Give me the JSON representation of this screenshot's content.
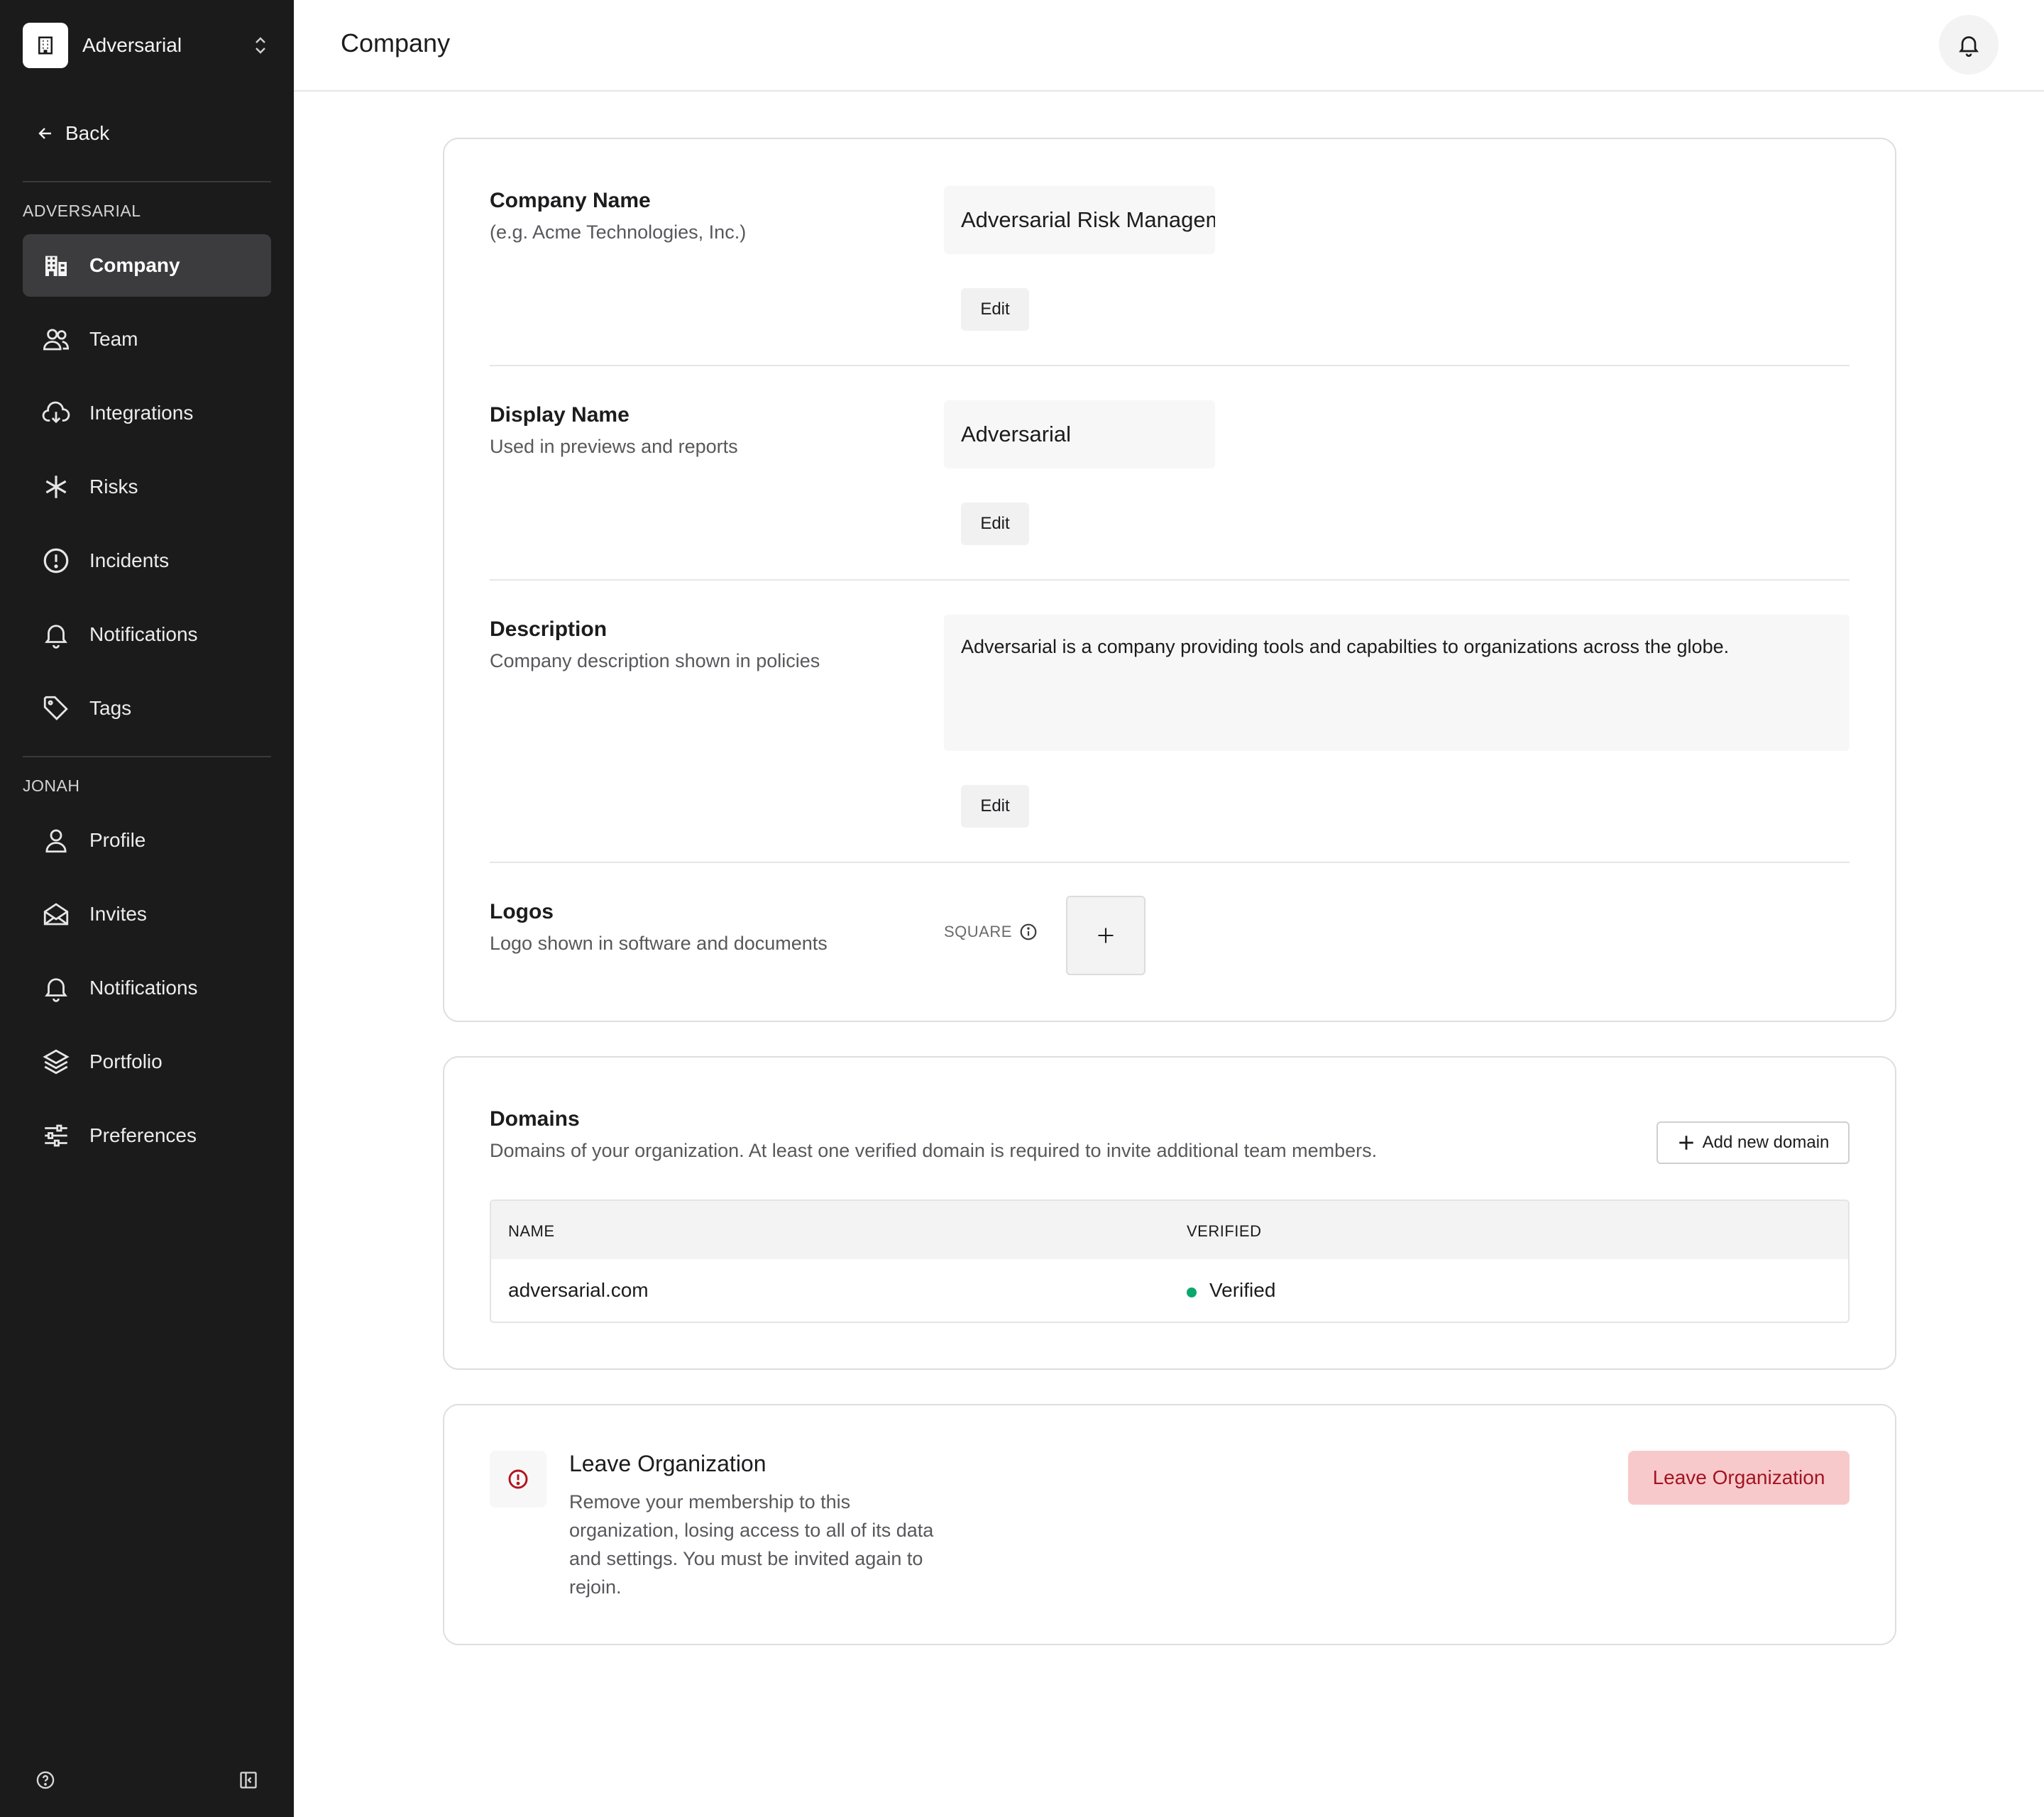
{
  "sidebar": {
    "org_name": "Adversarial",
    "back_label": "Back",
    "section_org": "ADVERSARIAL",
    "org_items": [
      {
        "label": "Company",
        "icon": "building-icon",
        "active": true
      },
      {
        "label": "Team",
        "icon": "users-icon"
      },
      {
        "label": "Integrations",
        "icon": "cloud-download-icon"
      },
      {
        "label": "Risks",
        "icon": "asterisk-icon"
      },
      {
        "label": "Incidents",
        "icon": "alert-circle-icon"
      },
      {
        "label": "Notifications",
        "icon": "bell-icon"
      },
      {
        "label": "Tags",
        "icon": "tag-icon"
      }
    ],
    "section_user": "JONAH",
    "user_items": [
      {
        "label": "Profile",
        "icon": "user-icon"
      },
      {
        "label": "Invites",
        "icon": "envelope-open-icon"
      },
      {
        "label": "Notifications",
        "icon": "bell-icon"
      },
      {
        "label": "Portfolio",
        "icon": "layers-icon"
      },
      {
        "label": "Preferences",
        "icon": "sliders-icon"
      }
    ],
    "footer_icons": [
      "help-circle-icon",
      "sidebar-collapse-icon"
    ]
  },
  "header": {
    "title": "Company",
    "notifications_icon": "bell-icon"
  },
  "company_card": {
    "company_name": {
      "label": "Company Name",
      "sub": "(e.g. Acme Technologies, Inc.)",
      "value": "Adversarial Risk Management",
      "edit": "Edit"
    },
    "display_name": {
      "label": "Display Name",
      "sub": "Used in previews and reports",
      "value": "Adversarial",
      "edit": "Edit"
    },
    "description": {
      "label": "Description",
      "sub": "Company description shown in policies",
      "value": "Adversarial is a company providing tools and capabilties to organizations across the globe.",
      "edit": "Edit"
    },
    "logos": {
      "label": "Logos",
      "sub": "Logo shown in software and documents",
      "square_label": "SQUARE",
      "add_icon": "plus-icon"
    }
  },
  "domains_card": {
    "title": "Domains",
    "sub": "Domains of your organization. At least one verified domain is required to invite additional team members.",
    "add_button": "Add new domain",
    "columns": [
      "NAME",
      "VERIFIED"
    ],
    "rows": [
      {
        "name": "adversarial.com",
        "status": "Verified",
        "status_color": "#0aa86e"
      }
    ]
  },
  "leave_card": {
    "title": "Leave Organization",
    "description": "Remove your membership to this organization, losing access to all of its data and settings. You must be invited again to rejoin.",
    "button": "Leave Organization",
    "accent": "#a11522"
  }
}
